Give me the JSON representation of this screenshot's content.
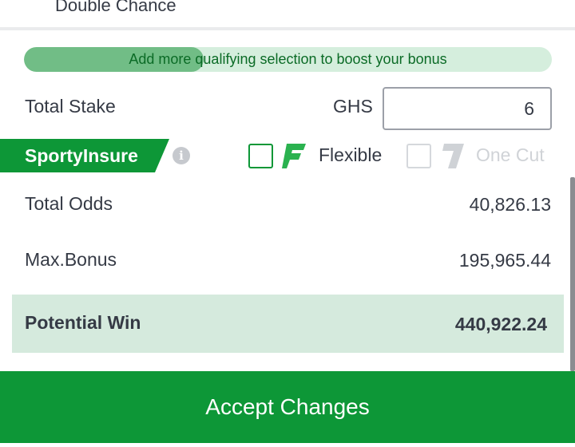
{
  "market": {
    "label": "Double Chance"
  },
  "boost": {
    "message": "Add more qualifying selection to boost your bonus",
    "progress": 0.34
  },
  "stake": {
    "label": "Total Stake",
    "currency": "GHS",
    "value": "6"
  },
  "insure": {
    "brand": "SportyInsure",
    "info_icon": "info-icon",
    "options": [
      {
        "label": "Flexible",
        "icon": "flexible-f-icon",
        "checked": false,
        "enabled": true
      },
      {
        "label": "One Cut",
        "icon": "one-cut-icon",
        "checked": false,
        "enabled": false
      }
    ]
  },
  "summary": {
    "total_odds_label": "Total Odds",
    "total_odds_value": "40,826.13",
    "max_bonus_label": "Max.Bonus",
    "max_bonus_value": "195,965.44",
    "potential_win_label": "Potential Win",
    "potential_win_value": "440,922.24"
  },
  "actions": {
    "accept_label": "Accept Changes"
  },
  "colors": {
    "brand_green": "#0d9737",
    "boost_fill": "#71bd86",
    "boost_track": "#d5eedd",
    "win_band": "#d5eadd",
    "text": "#353a45"
  }
}
